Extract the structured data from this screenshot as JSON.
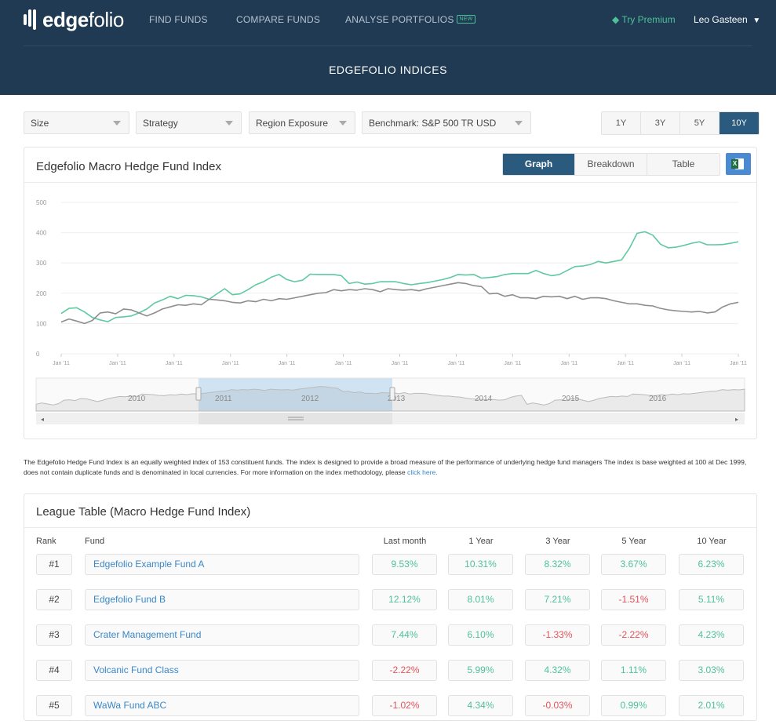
{
  "header": {
    "logo_text_bold": "edge",
    "logo_text_rest": "folio",
    "nav": [
      {
        "label": "FIND FUNDS"
      },
      {
        "label": "COMPARE FUNDS"
      },
      {
        "label": "ANALYSE PORTFOLIOS",
        "badge": "NEW"
      }
    ],
    "premium_label": "Try Premium",
    "user_name": "Leo Gasteen",
    "page_title": "EDGEFOLIO INDICES",
    "colors": {
      "bg": "#1f3a52",
      "accent": "#4fc19a"
    }
  },
  "filters": {
    "size": "Size",
    "strategy": "Strategy",
    "region": "Region Exposure",
    "benchmark": "Benchmark: S&P 500 TR USD",
    "periods": [
      "1Y",
      "3Y",
      "5Y",
      "10Y"
    ],
    "active_period": "10Y"
  },
  "chart_panel": {
    "title": "Edgefolio Macro Hedge Fund Index",
    "view_tabs": [
      "Graph",
      "Breakdown",
      "Table"
    ],
    "active_tab": "Graph",
    "export_icon": "excel-icon"
  },
  "chart_data": {
    "type": "line",
    "ylim": [
      0,
      500
    ],
    "yticks": [
      0,
      100,
      200,
      300,
      400,
      500
    ],
    "xticks": [
      "Jan '11",
      "Jan '11",
      "Jan '11",
      "Jan '11",
      "Jan '11",
      "Jan '11",
      "Jan '11",
      "Jan '11",
      "Jan '11",
      "Jan '11",
      "Jan '11",
      "Jan '11",
      "Jan '11"
    ],
    "grid": true,
    "series": [
      {
        "color": "#5fc9a0",
        "values": [
          133,
          150,
          152,
          138,
          120,
          112,
          106,
          120,
          122,
          125,
          135,
          148,
          168,
          178,
          190,
          182,
          193,
          192,
          188,
          180,
          198,
          215,
          195,
          198,
          212,
          228,
          238,
          253,
          262,
          245,
          238,
          243,
          263,
          262,
          262,
          262,
          258,
          232,
          237,
          230,
          232,
          238,
          238,
          238,
          232,
          228,
          232,
          235,
          240,
          245,
          252,
          262,
          260,
          262,
          250,
          252,
          255,
          262,
          265,
          265,
          265,
          275,
          265,
          258,
          262,
          275,
          288,
          290,
          295,
          305,
          300,
          305,
          310,
          348,
          398,
          403,
          392,
          362,
          350,
          352,
          358,
          365,
          370,
          360,
          360,
          361,
          365,
          370
        ]
      },
      {
        "color": "#8e8e8e",
        "values": [
          105,
          115,
          108,
          100,
          110,
          135,
          138,
          132,
          148,
          145,
          135,
          125,
          135,
          148,
          155,
          162,
          160,
          165,
          162,
          180,
          178,
          175,
          170,
          168,
          175,
          172,
          180,
          175,
          182,
          180,
          185,
          190,
          195,
          200,
          202,
          212,
          208,
          212,
          210,
          215,
          212,
          205,
          215,
          212,
          210,
          212,
          208,
          215,
          220,
          225,
          230,
          235,
          232,
          225,
          222,
          198,
          200,
          190,
          195,
          185,
          185,
          182,
          190,
          188,
          190,
          182,
          190,
          180,
          185,
          185,
          182,
          175,
          170,
          165,
          165,
          160,
          158,
          150,
          145,
          142,
          140,
          138,
          140,
          135,
          138,
          155,
          165,
          170
        ]
      }
    ],
    "navigator": {
      "year_labels": [
        "2010",
        "2011",
        "2012",
        "2013",
        "2014",
        "2015",
        "2016"
      ],
      "selected_range": [
        "2011",
        "2013"
      ]
    }
  },
  "description": {
    "text": "The Edgefolio Hedge Fund Index is an equally weighted index of 153 constituent funds. The index is designed to provide a broad measure of the performance of underlying hedge fund managers The index is base weighted at 100 at Dec 1999, does not contain duplicate funds and is denominated in local currencies. For more information on the index methodology, please ",
    "link": "click here."
  },
  "league_table": {
    "title": "League Table (Macro Hedge Fund Index)",
    "columns": [
      "Rank",
      "Fund",
      "Last month",
      "1 Year",
      "3 Year",
      "5 Year",
      "10 Year"
    ],
    "rows": [
      {
        "rank": "#1",
        "fund": "Edgefolio Example Fund A",
        "values": [
          "9.53%",
          "10.31%",
          "8.32%",
          "3.67%",
          "6.23%"
        ]
      },
      {
        "rank": "#2",
        "fund": "Edgefolio Fund B",
        "values": [
          "12.12%",
          "8.01%",
          "7.21%",
          "-1.51%",
          "5.11%"
        ]
      },
      {
        "rank": "#3",
        "fund": "Crater Management Fund",
        "values": [
          "7.44%",
          "6.10%",
          "-1.33%",
          "-2.22%",
          "4.23%"
        ]
      },
      {
        "rank": "#4",
        "fund": "Volcanic Fund Class",
        "values": [
          "-2.22%",
          "5.99%",
          "4.32%",
          "1.11%",
          "3.03%"
        ]
      },
      {
        "rank": "#5",
        "fund": "WaWa Fund ABC",
        "values": [
          "-1.02%",
          "4.34%",
          "-0.03%",
          "0.99%",
          "2.01%"
        ]
      }
    ],
    "colors": {
      "positive": "#4fc19a",
      "negative": "#e3525a"
    }
  }
}
